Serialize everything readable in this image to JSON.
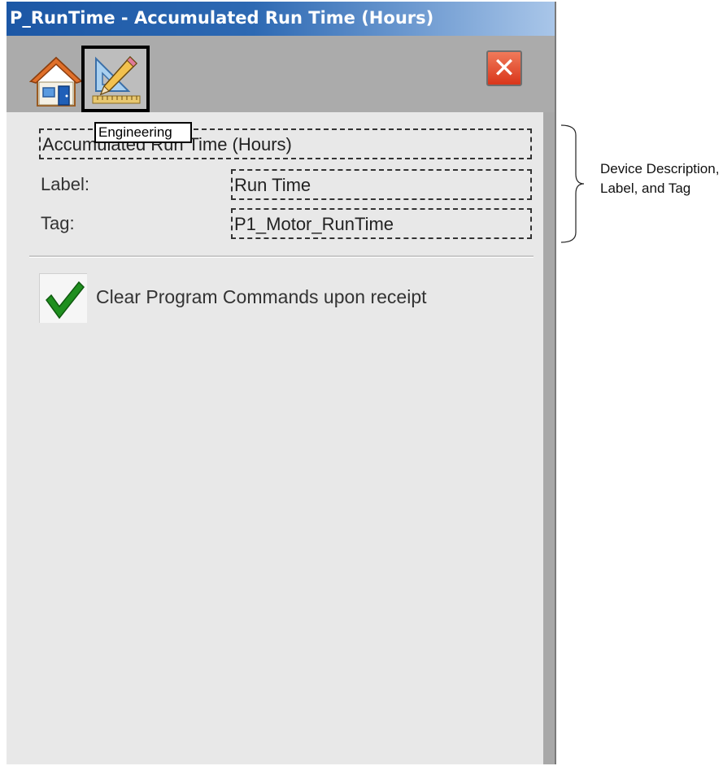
{
  "window": {
    "title": "P_RunTime - Accumulated Run Time (Hours)"
  },
  "toolbar": {
    "home_icon": "home-icon",
    "engineering_icon": "engineering-icon",
    "close_icon": "close-icon",
    "tooltip": "Engineering"
  },
  "form": {
    "description_value": "Accumulated Run Time (Hours)",
    "label_name": "Label:",
    "label_value": "Run Time",
    "tag_name": "Tag:",
    "tag_value": "P1_Motor_RunTime",
    "checkbox_label": "Clear Program Commands upon receipt",
    "checkbox_checked": true
  },
  "annotation": {
    "line1": "Device Description,",
    "line2": "Label, and Tag"
  },
  "colors": {
    "titlebar_start": "#1c57a5",
    "titlebar_end": "#a9c6e9",
    "close_red": "#d9351a",
    "check_green": "#1f8f1f"
  }
}
